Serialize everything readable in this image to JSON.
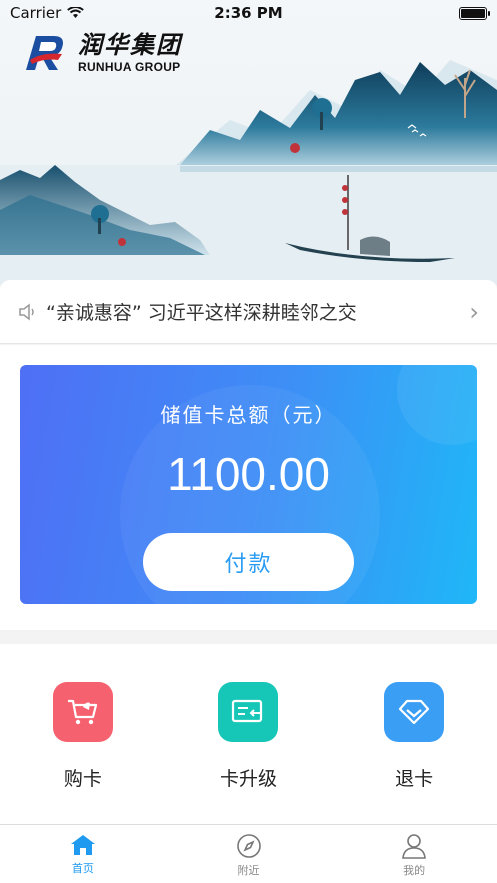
{
  "status_bar": {
    "carrier": "Carrier",
    "time": "2:36 PM"
  },
  "logo": {
    "cn": "润华集团",
    "en": "RUNHUA GROUP"
  },
  "notice": {
    "text": "“亲诚惠容” 习近平这样深耕睦邻之交"
  },
  "card": {
    "label": "储值卡总额（元）",
    "amount": "1100.00",
    "pay_label": "付款"
  },
  "actions": [
    {
      "label": "购卡",
      "icon": "shopping-cart-icon",
      "color": "#f6616f"
    },
    {
      "label": "卡升级",
      "icon": "card-upgrade-icon",
      "color": "#16c7b7"
    },
    {
      "label": "退卡",
      "icon": "diamond-icon",
      "color": "#3b9ef5"
    }
  ],
  "tabs": [
    {
      "label": "首页",
      "icon": "home-icon",
      "active": true
    },
    {
      "label": "附近",
      "icon": "compass-icon",
      "active": false
    },
    {
      "label": "我的",
      "icon": "user-icon",
      "active": false
    }
  ],
  "colors": {
    "accent": "#1e9af0"
  }
}
